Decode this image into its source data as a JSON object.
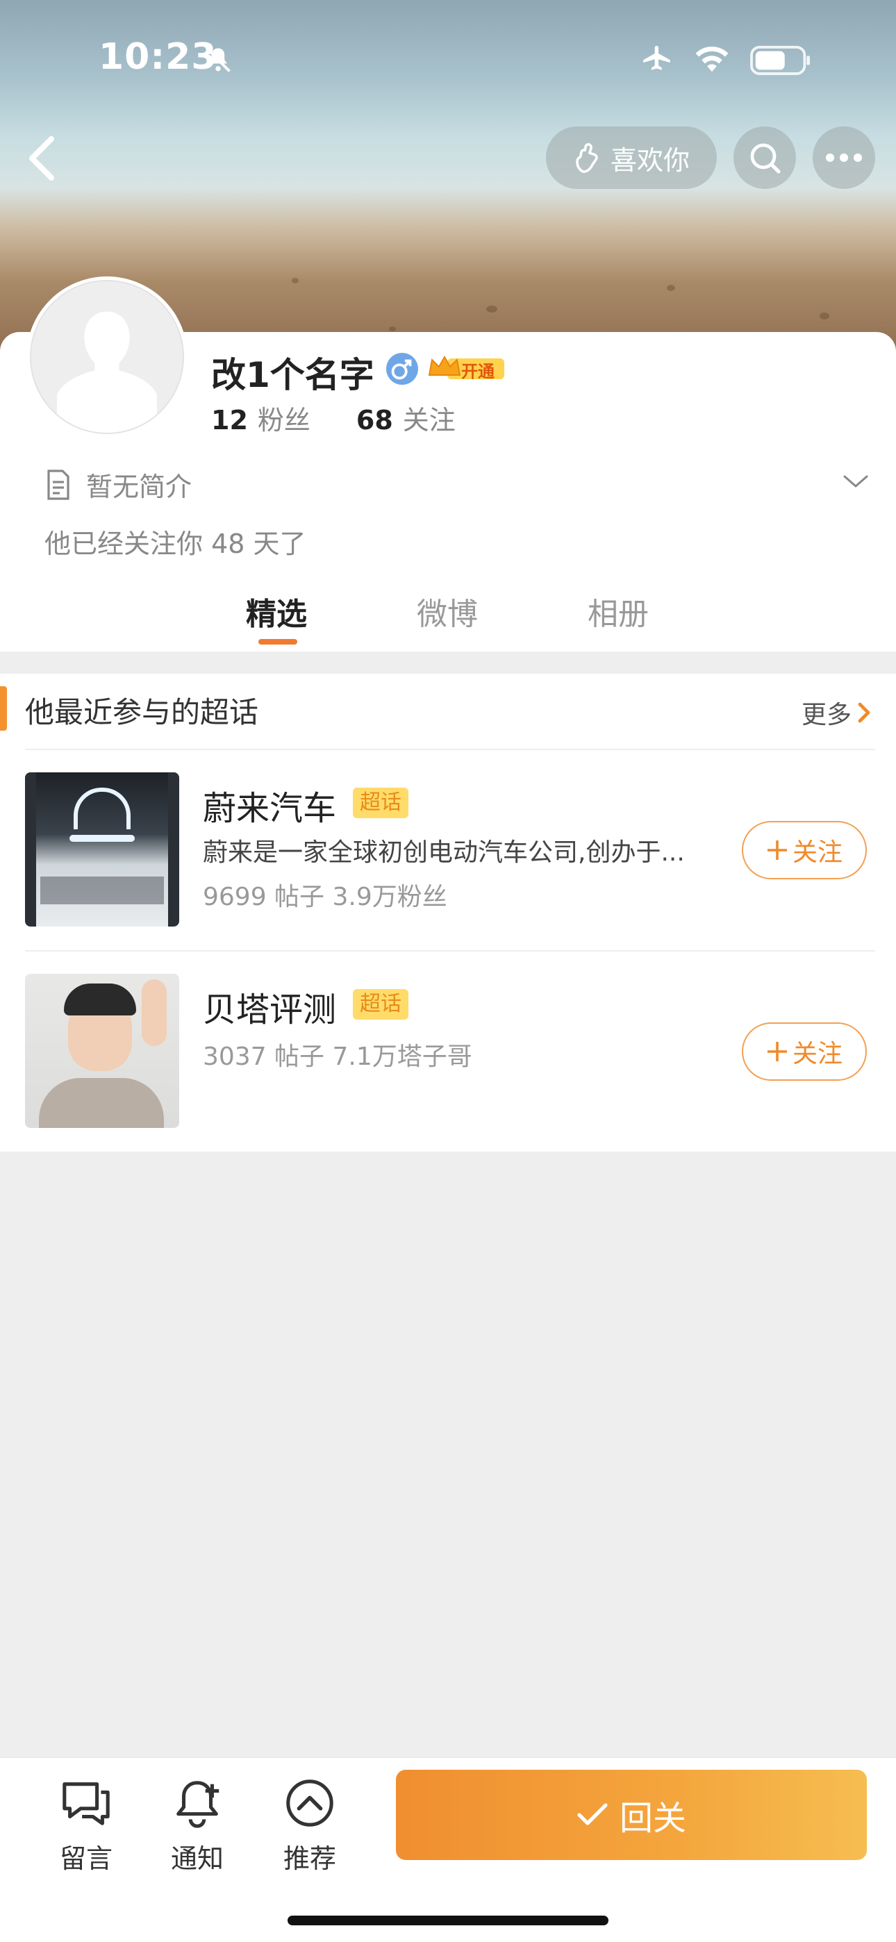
{
  "status_bar": {
    "time": "10:23"
  },
  "header": {
    "like_label": "喜欢你"
  },
  "profile": {
    "username": "改1个名字",
    "vip_label": "开通",
    "fans_count": "12",
    "fans_label": "粉丝",
    "following_count": "68",
    "following_label": "关注",
    "bio": "暂无简介",
    "follow_duration": "他已经关注你 48 天了"
  },
  "tabs": [
    {
      "label": "精选",
      "active": true
    },
    {
      "label": "微博",
      "active": false
    },
    {
      "label": "相册",
      "active": false
    }
  ],
  "topics_section": {
    "title": "他最近参与的超话",
    "more_label": "更多",
    "items": [
      {
        "name": "蔚来汽车",
        "badge": "超话",
        "description": "蔚来是一家全球初创电动汽车公司,创办于...",
        "stats": "9699 帖子  3.9万粉丝",
        "follow_label": "关注"
      },
      {
        "name": "贝塔评测",
        "badge": "超话",
        "description": "",
        "stats": "3037 帖子  7.1万塔子哥",
        "follow_label": "关注"
      }
    ]
  },
  "bottom_bar": {
    "message_label": "留言",
    "notify_label": "通知",
    "recommend_label": "推荐",
    "reply_label": "回关"
  },
  "colors": {
    "accent": "#f08a2a",
    "badge_bg": "#ffdb6a",
    "page_bg": "#eeeeee"
  }
}
